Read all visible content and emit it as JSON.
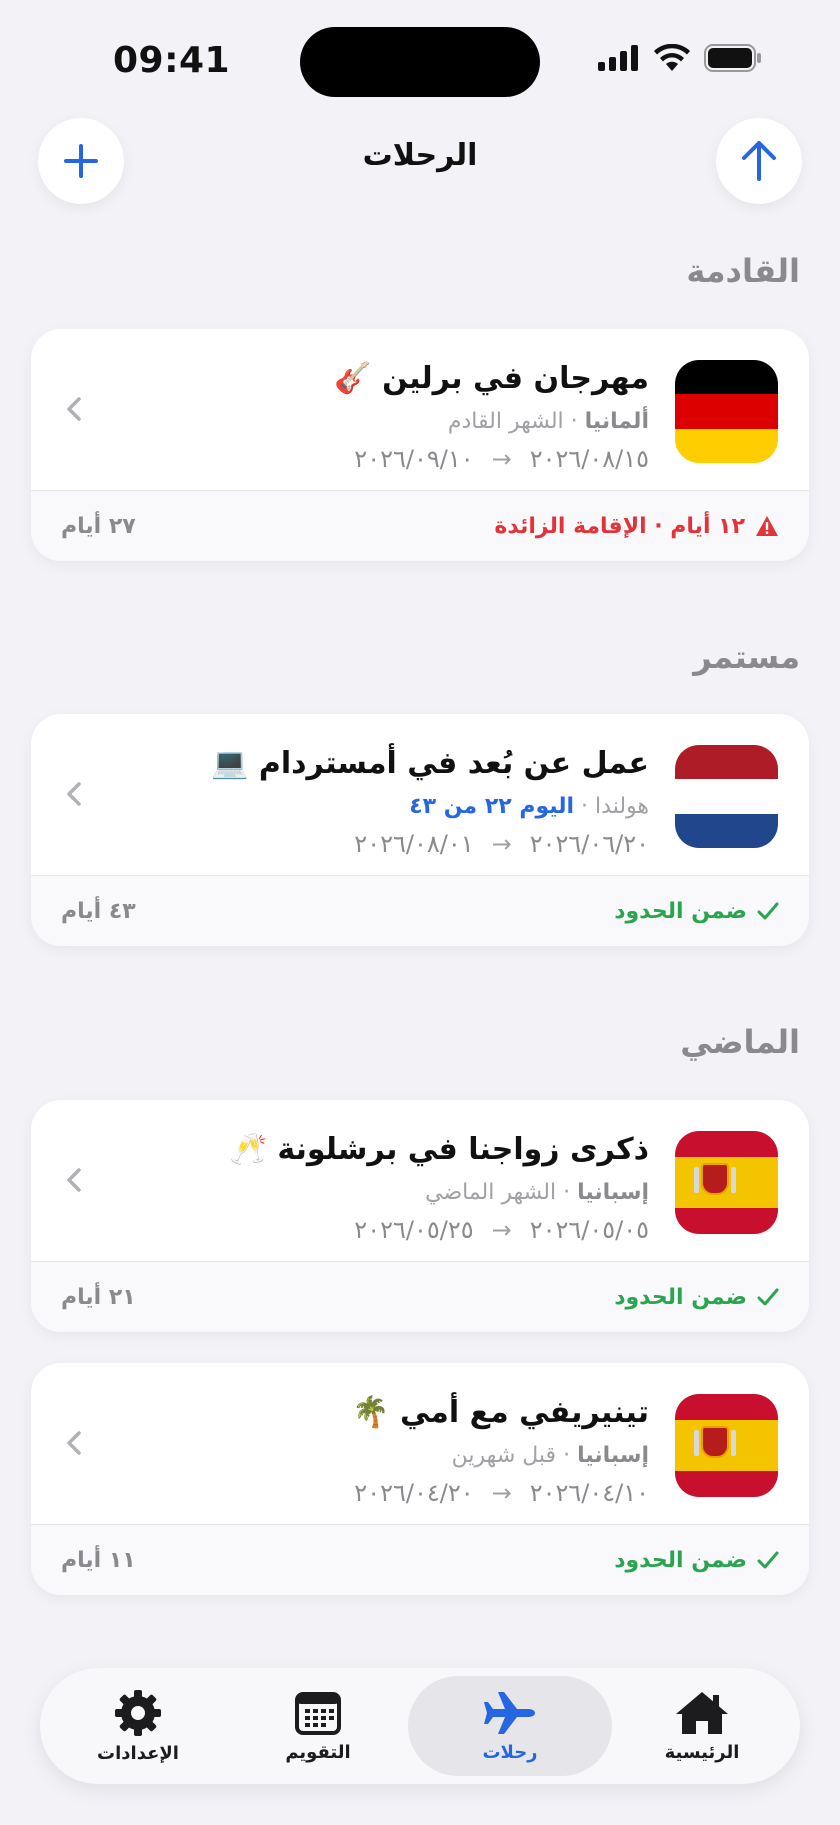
{
  "status_bar": {
    "time": "09:41"
  },
  "header": {
    "title": "الرحلات"
  },
  "sections": {
    "upcoming": "القادمة",
    "ongoing": "مستمر",
    "past": "الماضي"
  },
  "trips": [
    {
      "title": "مهرجان في برلين 🎸",
      "country": "ألمانيا",
      "sep": "·",
      "relative": "الشهر القادم",
      "start": "٢٠٢٦/٠٨/١٥",
      "end": "٢٠٢٦/٠٩/١٠",
      "arrow": "→",
      "status": "١٢ أيام · الإقامة الزائدة",
      "status_type": "warning",
      "days": "٢٧ أيام",
      "flag": "germany",
      "colors": [
        "#000000",
        "#dd0000",
        "#ffce00"
      ]
    },
    {
      "title": "عمل عن بُعد في أمستردام 💻",
      "country": "هولندا",
      "sep": "·",
      "relative": "اليوم ٢٢ من ٤٣",
      "start": "٢٠٢٦/٠٦/٢٠",
      "end": "٢٠٢٦/٠٨/٠١",
      "arrow": "→",
      "status": "ضمن الحدود",
      "status_type": "ok",
      "days": "٤٣ أيام",
      "flag": "netherlands",
      "colors": [
        "#ae1c28",
        "#ffffff",
        "#21468b"
      ]
    },
    {
      "title": "ذكرى زواجنا في برشلونة 🥂",
      "country": "إسبانيا",
      "sep": "·",
      "relative": "الشهر الماضي",
      "start": "٢٠٢٦/٠٥/٠٥",
      "end": "٢٠٢٦/٠٥/٢٥",
      "arrow": "→",
      "status": "ضمن الحدود",
      "status_type": "ok",
      "days": "٢١ أيام",
      "flag": "spain"
    },
    {
      "title": "تينيريفي مع أمي 🌴",
      "country": "إسبانيا",
      "sep": "·",
      "relative": "قبل شهرين",
      "start": "٢٠٢٦/٠٤/١٠",
      "end": "٢٠٢٦/٠٤/٢٠",
      "arrow": "→",
      "status": "ضمن الحدود",
      "status_type": "ok",
      "days": "١١ أيام",
      "flag": "spain"
    }
  ],
  "tabbar": {
    "home": "الرئيسية",
    "trips": "رحلات",
    "calendar": "التقويم",
    "settings": "الإعدادات"
  },
  "accent_color": "#2666e0",
  "warning_color": "#e0343a",
  "ok_color": "#2aa44f"
}
